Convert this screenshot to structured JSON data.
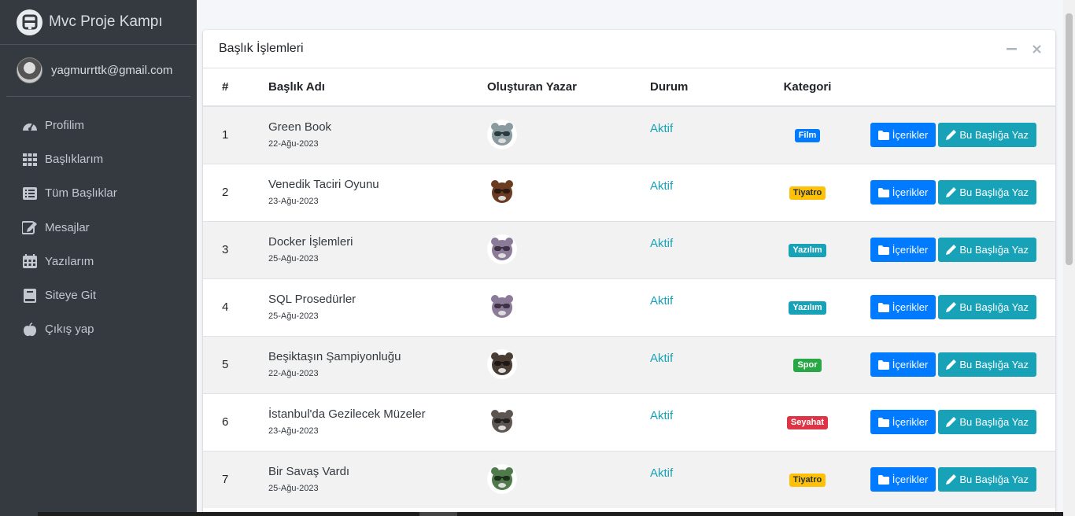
{
  "sidebar": {
    "brand": "Mvc Proje Kampı",
    "user_email": "yagmurrttk@gmail.com",
    "items": [
      {
        "label": "Profilim",
        "icon": "tachometer-icon"
      },
      {
        "label": "Başlıklarım",
        "icon": "grid-icon"
      },
      {
        "label": "Tüm Başlıklar",
        "icon": "list-icon"
      },
      {
        "label": "Mesajlar",
        "icon": "edit-icon"
      },
      {
        "label": "Yazılarım",
        "icon": "calendar-icon"
      },
      {
        "label": "Siteye Git",
        "icon": "book-icon"
      },
      {
        "label": "Çıkış yap",
        "icon": "apple-icon"
      }
    ]
  },
  "card": {
    "title": "Başlık İşlemleri"
  },
  "table": {
    "headers": [
      "#",
      "Başlık Adı",
      "Oluşturan Yazar",
      "Durum",
      "Kategori"
    ],
    "rows": [
      {
        "num": "1",
        "title": "Green Book",
        "date": "22-Ağu-2023",
        "status": "Aktif",
        "category": "Film",
        "badge": "primary"
      },
      {
        "num": "2",
        "title": "Venedik Taciri Oyunu",
        "date": "23-Ağu-2023",
        "status": "Aktif",
        "category": "Tiyatro",
        "badge": "warning"
      },
      {
        "num": "3",
        "title": "Docker İşlemleri",
        "date": "25-Ağu-2023",
        "status": "Aktif",
        "category": "Yazılım",
        "badge": "info"
      },
      {
        "num": "4",
        "title": "SQL Prosedürler",
        "date": "25-Ağu-2023",
        "status": "Aktif",
        "category": "Yazılım",
        "badge": "info"
      },
      {
        "num": "5",
        "title": "Beşiktaşın Şampiyonluğu",
        "date": "22-Ağu-2023",
        "status": "Aktif",
        "category": "Spor",
        "badge": "success"
      },
      {
        "num": "6",
        "title": "İstanbul'da Gezilecek Müzeler",
        "date": "23-Ağu-2023",
        "status": "Aktif",
        "category": "Seyahat",
        "badge": "danger"
      },
      {
        "num": "7",
        "title": "Bir Savaş Vardı",
        "date": "25-Ağu-2023",
        "status": "Aktif",
        "category": "Tiyatro",
        "badge": "warning"
      }
    ],
    "button_contents": "İçerikler",
    "button_write": "Bu Başlığa Yaz"
  },
  "colors": {
    "sidebar_bg": "#343a40",
    "primary": "#007bff",
    "info": "#17a2b8",
    "warning": "#ffc107",
    "success": "#28a745",
    "danger": "#dc3545"
  }
}
